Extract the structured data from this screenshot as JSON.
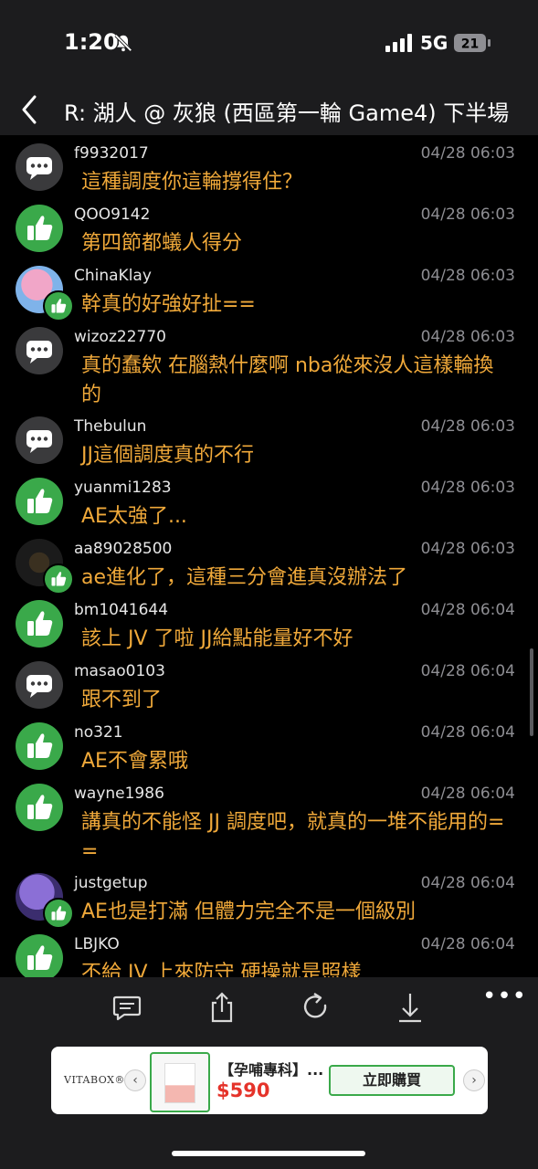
{
  "status_bar": {
    "time": "1:20",
    "network": "5G",
    "battery": "21"
  },
  "header": {
    "title": "R: 湖人 @ 灰狼 (西區第一輪 Game4) 下半場"
  },
  "comments": [
    {
      "user": "f9932017",
      "date": "04/28 06:03",
      "text": "這種調度你這輪撐得住？",
      "avatar": "comment-icon"
    },
    {
      "user": "QOO9142",
      "date": "04/28 06:03",
      "text": "第四節都蟻人得分",
      "avatar": "thumbs-up-icon"
    },
    {
      "user": "ChinaKlay",
      "date": "04/28 06:03",
      "text": "幹真的好強好扯==",
      "avatar": "user-photo"
    },
    {
      "user": "wizoz22770",
      "date": "04/28 06:03",
      "text": "真的蠢欸 在腦熱什麼啊 nba從來沒人這樣輪換的",
      "avatar": "comment-icon"
    },
    {
      "user": "Thebulun",
      "date": "04/28 06:03",
      "text": "JJ這個調度真的不行",
      "avatar": "comment-icon"
    },
    {
      "user": "yuanmi1283",
      "date": "04/28 06:03",
      "text": "AE太強了...",
      "avatar": "thumbs-up-icon"
    },
    {
      "user": "aa89028500",
      "date": "04/28 06:03",
      "text": "ae進化了，這種三分會進真沒辦法了",
      "avatar": "user-photo"
    },
    {
      "user": "bm1041644",
      "date": "04/28 06:04",
      "text": "該上 JV 了啦 JJ給點能量好不好",
      "avatar": "thumbs-up-icon"
    },
    {
      "user": "masao0103",
      "date": "04/28 06:04",
      "text": "跟不到了",
      "avatar": "comment-icon"
    },
    {
      "user": "no321",
      "date": "04/28 06:04",
      "text": "AE不會累哦",
      "avatar": "thumbs-up-icon"
    },
    {
      "user": "wayne1986",
      "date": "04/28 06:04",
      "text": "講真的不能怪 JJ 調度吧，就真的一堆不能用的= =",
      "avatar": "thumbs-up-icon"
    },
    {
      "user": "justgetup",
      "date": "04/28 06:04",
      "text": "AE也是打滿 但體力完全不是一個級別",
      "avatar": "user-photo"
    },
    {
      "user": "LBJKO",
      "date": "04/28 06:04",
      "text": "不給 JV 上來防守 硬操就是照樣",
      "avatar": "thumbs-up-icon"
    }
  ],
  "toolbar": {
    "icons": [
      "comment-icon",
      "share-icon",
      "refresh-icon",
      "download-icon"
    ],
    "more_label": "•••"
  },
  "ad": {
    "brand": "VITABOX®",
    "title": "【孕哺專科】...",
    "price": "$590",
    "buy_label": "立即購買",
    "prev_label": "‹",
    "next_label": "›"
  },
  "colors": {
    "comment_text": "#f0a93a",
    "like_green": "#3aa94a",
    "price_red": "#e5332a"
  }
}
